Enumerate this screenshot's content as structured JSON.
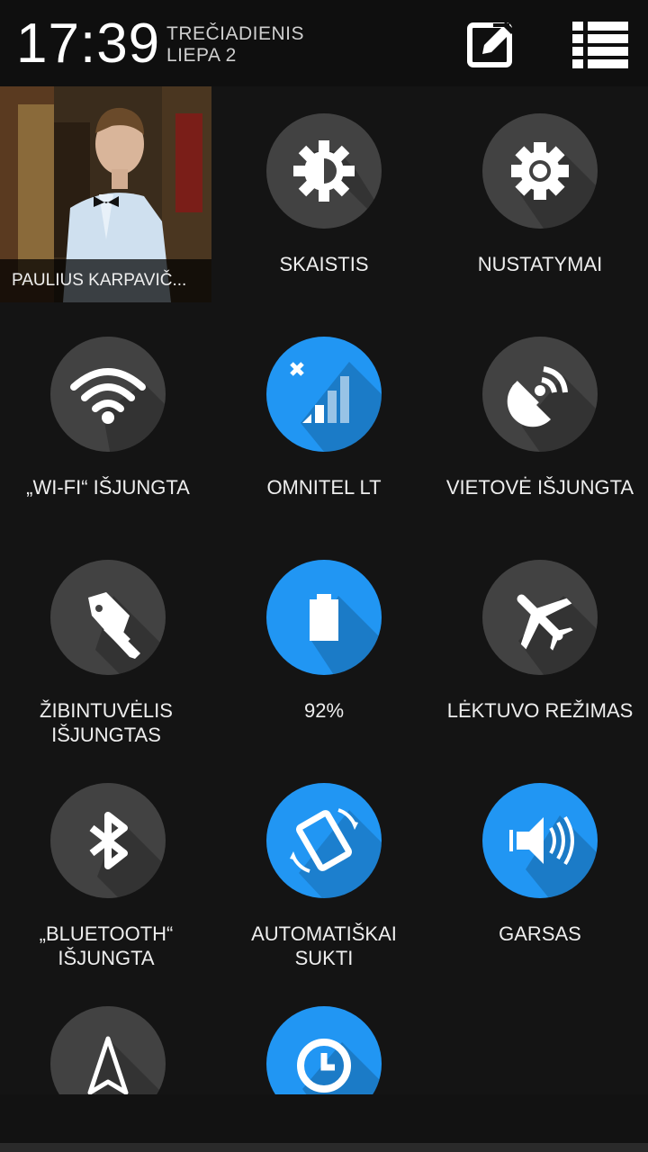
{
  "header": {
    "time": "17:39",
    "weekday": "TREČIADIENIS",
    "date": "LIEPA 2",
    "edit_icon": "edit-icon",
    "list_icon": "list-icon"
  },
  "profile": {
    "name": "PAULIUS KARPAVIČ..."
  },
  "tiles": [
    {
      "label": "SKAISTIS",
      "icon": "brightness-icon",
      "active": false
    },
    {
      "label": "NUSTATYMAI",
      "icon": "gear-icon",
      "active": false
    },
    {
      "label": "„WI-FI“ IŠJUNGTA",
      "icon": "wifi-icon",
      "active": false
    },
    {
      "label": "OMNITEL LT",
      "icon": "signal-icon",
      "active": true
    },
    {
      "label": "VIETOVĖ IŠJUNGTA",
      "icon": "location-icon",
      "active": false
    },
    {
      "label": "ŽIBINTUVĖLIS IŠJUNGTAS",
      "icon": "flashlight-icon",
      "active": false
    },
    {
      "label": "92%",
      "icon": "battery-icon",
      "active": true
    },
    {
      "label": "LĖKTUVO REŽIMAS",
      "icon": "airplane-icon",
      "active": false
    },
    {
      "label": "„BLUETOOTH“ IŠJUNGTA",
      "icon": "bluetooth-icon",
      "active": false
    },
    {
      "label": "AUTOMATIŠKAI SUKTI",
      "icon": "rotate-icon",
      "active": true
    },
    {
      "label": "GARSAS",
      "icon": "volume-icon",
      "active": true
    },
    {
      "label": "",
      "icon": "navigation-icon",
      "active": false
    },
    {
      "label": "",
      "icon": "clock-icon",
      "active": true
    }
  ]
}
